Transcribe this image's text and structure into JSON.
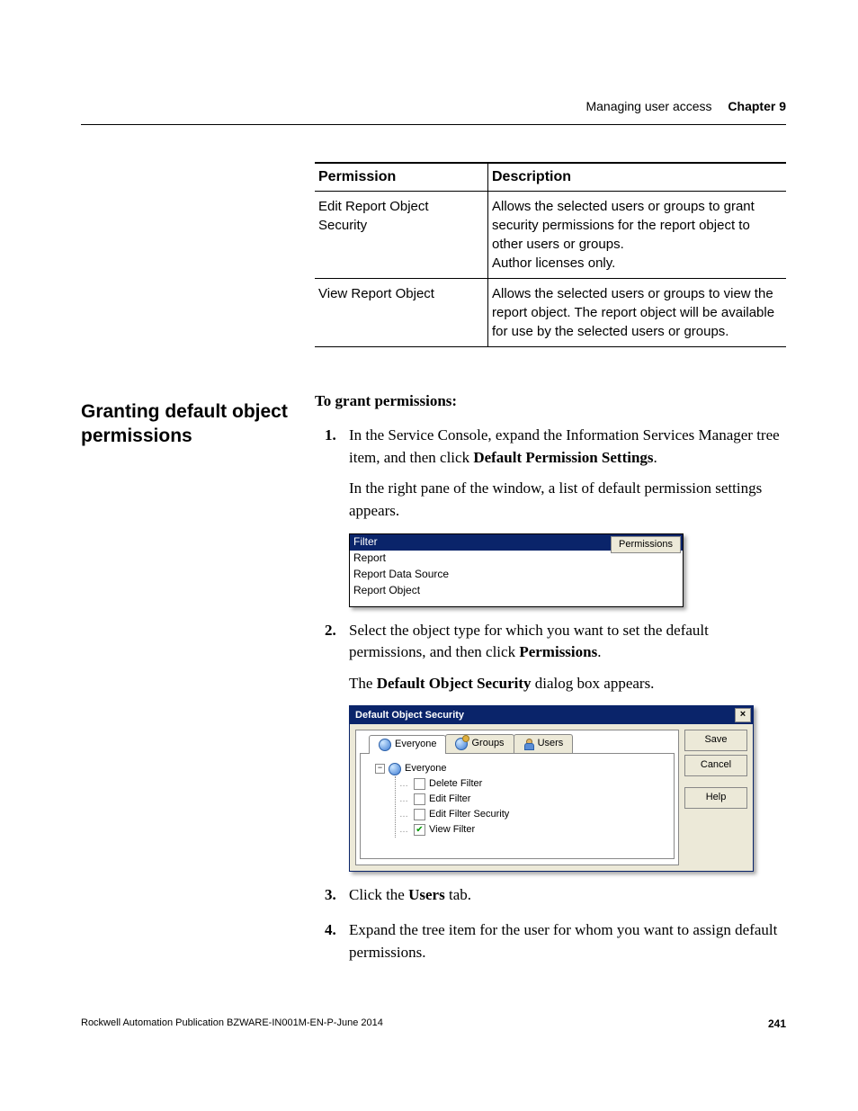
{
  "header": {
    "sectionTitle": "Managing user access",
    "chapterLabel": "Chapter 9"
  },
  "permissionsTable": {
    "headers": {
      "col1": "Permission",
      "col2": "Description"
    },
    "rows": [
      {
        "perm": "Edit Report Object Security",
        "desc": "Allows the selected users or groups to grant security permissions for the report object to other users or groups.\nAuthor licenses only."
      },
      {
        "perm": "View Report Object",
        "desc": "Allows the selected users or groups to view the report object. The report object will be available for use by the selected users or groups."
      }
    ]
  },
  "sidebarHeading": "Granting default object permissions",
  "procedure": {
    "title": "To grant permissions:",
    "step1_a": "In the Service Console, expand the Information Services Manager tree item, and then click ",
    "step1_bold": "Default Permission Settings",
    "step1_b": ".",
    "step1_follow": "In the right pane of the window, a list of default permission settings appears.",
    "step2_a": "Select the object type for which you want to set the default permissions, and then click ",
    "step2_bold": "Permissions",
    "step2_b": ".",
    "step2_follow_a": "The ",
    "step2_follow_bold": "Default Object Security",
    "step2_follow_b": " dialog box appears.",
    "step3_a": "Click the ",
    "step3_bold": "Users",
    "step3_b": " tab.",
    "step4": "Expand the tree item for the user for whom you want to assign default permissions."
  },
  "shot1": {
    "items": [
      "Filter",
      "Report",
      "Report Data Source",
      "Report Object"
    ],
    "buttonLabel": "Permissions"
  },
  "dialog": {
    "title": "Default Object Security",
    "tabs": {
      "everyone": "Everyone",
      "groups": "Groups",
      "users": "Users"
    },
    "buttons": {
      "save": "Save",
      "cancel": "Cancel",
      "help": "Help"
    },
    "tree": {
      "root": "Everyone",
      "items": [
        {
          "label": "Delete Filter",
          "checked": false
        },
        {
          "label": "Edit Filter",
          "checked": false
        },
        {
          "label": "Edit Filter Security",
          "checked": false
        },
        {
          "label": "View Filter",
          "checked": true
        }
      ]
    }
  },
  "footer": {
    "publication": "Rockwell Automation Publication BZWARE-IN001M-EN-P-June 2014",
    "pageNumber": "241"
  }
}
